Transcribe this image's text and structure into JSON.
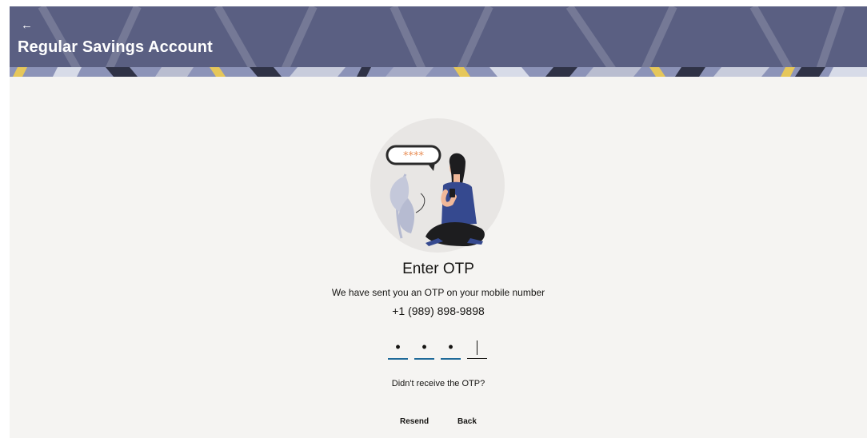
{
  "header": {
    "back_icon": "left-arrow-icon",
    "back_glyph": "←",
    "title": "Regular Savings Account",
    "background_color": "#5a5f82"
  },
  "main": {
    "illustration": "woman-with-phone-otp-illustration",
    "illustration_badge_text": "****",
    "heading": "Enter OTP",
    "subtext": "We have sent you an OTP on your mobile number",
    "phone_number": "+1 (989) 898-9898",
    "otp_fields": [
      {
        "value": "•",
        "filled": true
      },
      {
        "value": "•",
        "filled": true
      },
      {
        "value": "•",
        "filled": true
      },
      {
        "value": "",
        "filled": false
      }
    ],
    "resend_question": "Didn't receive the OTP?",
    "resend_label": "Resend",
    "back_label": "Back"
  },
  "colors": {
    "accent": "#1f6a99",
    "page_background": "#f5f4f2",
    "text": "#161513"
  }
}
